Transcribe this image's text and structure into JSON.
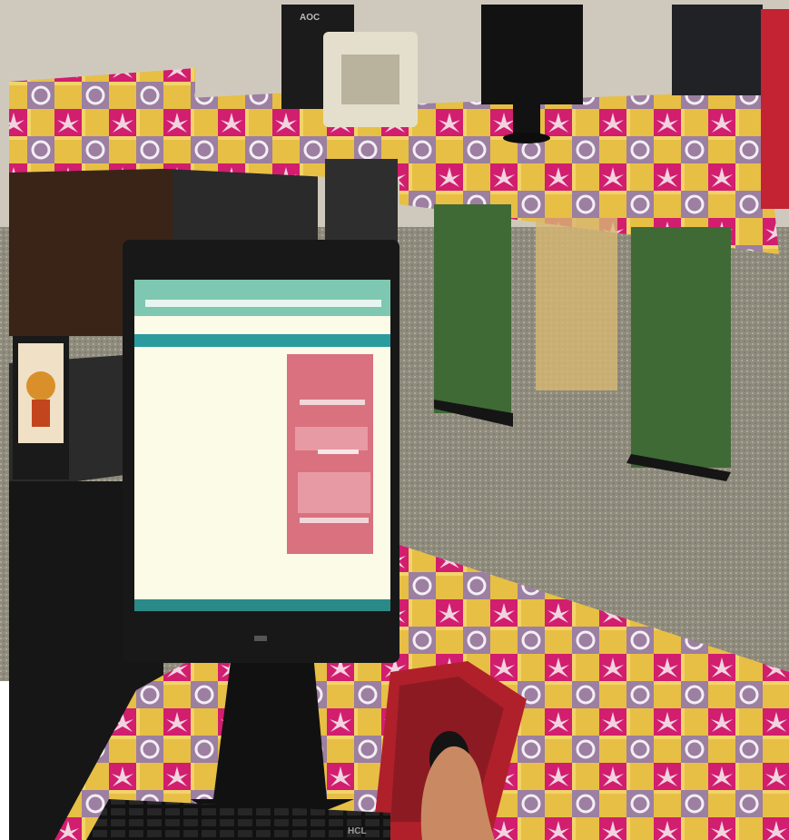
{
  "scene": {
    "description_kind": "photo",
    "brands": {
      "back_monitor_logo": "AOC",
      "keyboard_logo": "HCL"
    },
    "colors": {
      "wall": "#cfc9bd",
      "floor": "#8f8c7e",
      "tablecloth_pink": "#d21e6e",
      "tablecloth_yellow": "#e7bf45",
      "tablecloth_lavender": "#9c7fa1",
      "desk_green": "#3f6a35",
      "desk_dark": "#1f1f1f",
      "monitor_bezel": "#181818",
      "screen_bg": "#fbfbe8",
      "screen_toolbar": "#2c9b9e",
      "screen_header": "#7ec7b0",
      "form_pink": "#d9717f",
      "taskbar_teal": "#2b8a88",
      "mousepad_red": "#b0202a"
    }
  }
}
